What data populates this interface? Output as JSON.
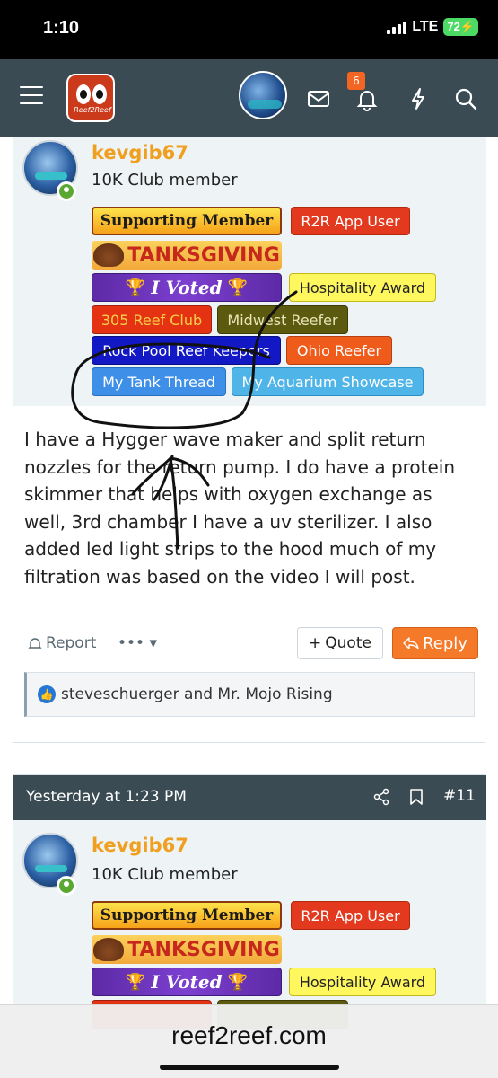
{
  "status_bar": {
    "time": "1:10",
    "network": "LTE",
    "battery": "72"
  },
  "nav": {
    "notification_count": "6",
    "logo_text": "Reef2Reef"
  },
  "post1": {
    "username": "kevgib67",
    "user_title": "10K Club member",
    "banners": {
      "supporting": "Supporting Member",
      "r2r_app": "R2R App User",
      "thanksgiving": "TANKSGIVING",
      "voted": "I Voted",
      "hospitality": "Hospitality Award",
      "reef_club_305": "305 Reef Club",
      "midwest": "Midwest Reefer",
      "rock_pool": "Rock Pool Reef Keepers",
      "ohio": "Ohio Reefer",
      "my_tank_thread": "My Tank Thread",
      "aquarium_showcase": "My Aquarium Showcase"
    },
    "body": "I have a Hygger wave maker and split return nozzles for the return pump. I do have a protein skimmer that helps with oxygen exchange as well, 3rd chamber I have a uv sterilizer. I also added led light strips to the hood much of my filtration was based on the video I will post.",
    "actions": {
      "report": "Report",
      "more": "•••",
      "quote": "Quote",
      "reply": "Reply"
    },
    "likes": "steveschuerger and Mr. Mojo Rising"
  },
  "post2": {
    "timestamp": "Yesterday at 1:23 PM",
    "post_number": "#11",
    "username": "kevgib67",
    "user_title": "10K Club member",
    "banners": {
      "supporting": "Supporting Member",
      "r2r_app": "R2R App User",
      "thanksgiving": "TANKSGIVING",
      "voted": "I Voted",
      "hospitality": "Hospitality Award"
    }
  },
  "browser": {
    "url": "reef2reef.com"
  },
  "icons": {
    "menu": "hamburger-icon",
    "inbox": "envelope-icon",
    "alerts": "bell-icon",
    "whats_new": "bolt-icon",
    "search": "search-icon",
    "share": "share-icon",
    "bookmark": "bookmark-icon",
    "like": "thumbs-up-icon"
  },
  "colors": {
    "nav_bg": "#3a4b54",
    "username": "#f0a020",
    "reply": "#f47a2a",
    "badge": "#f26522"
  }
}
